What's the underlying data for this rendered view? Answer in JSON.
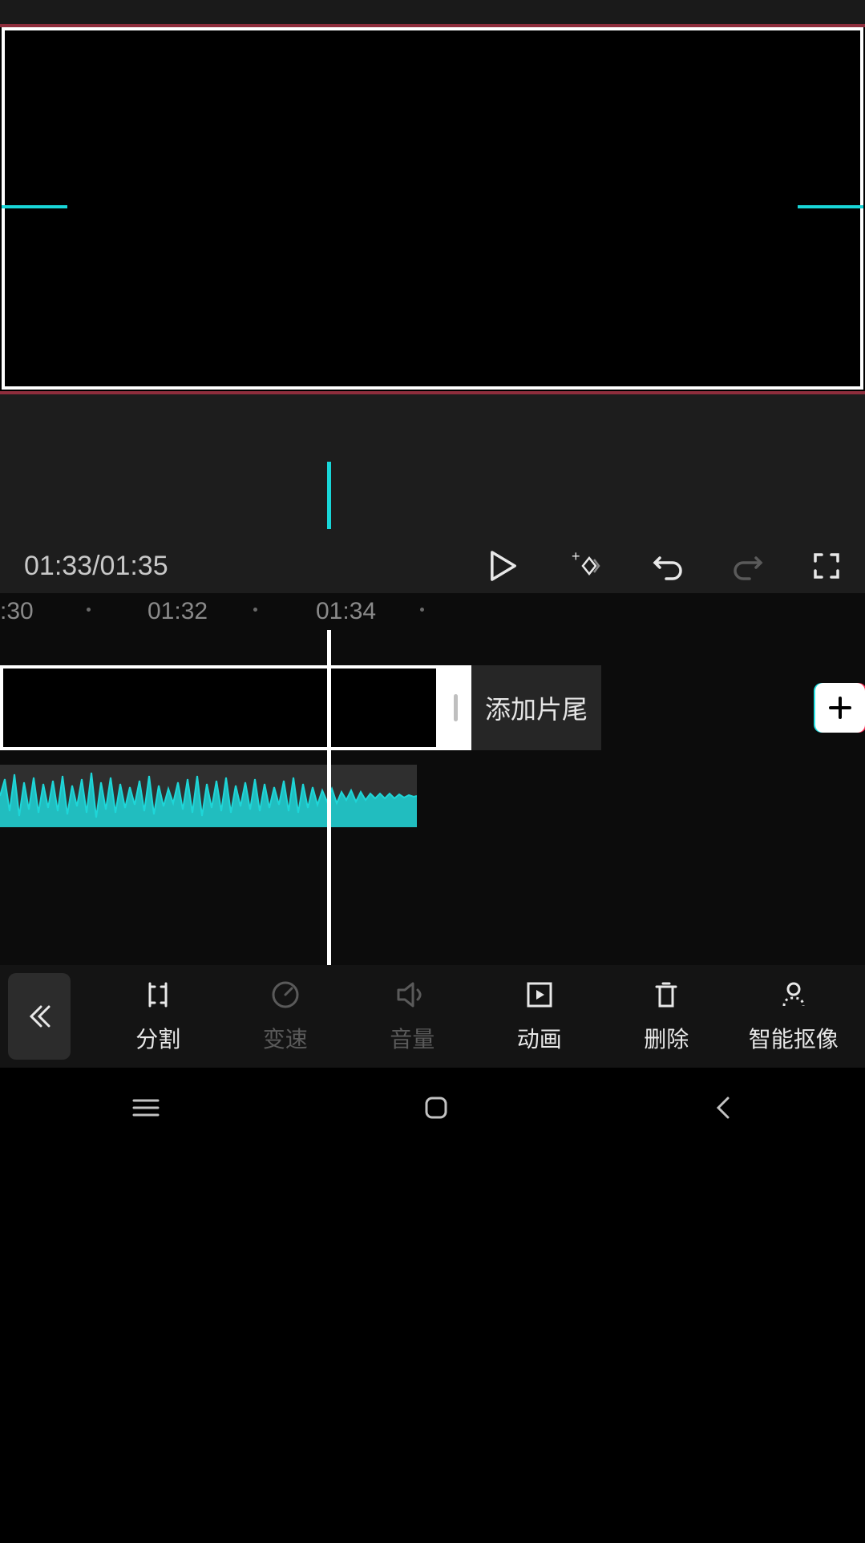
{
  "playback": {
    "time_label": "01:33/01:35"
  },
  "ruler": {
    "t0": ":30",
    "t1": "01:32",
    "t2": "01:34"
  },
  "timeline": {
    "add_tail_label": "添加片尾"
  },
  "toolbar": {
    "split": "分割",
    "speed": "变速",
    "volume": "音量",
    "animation": "动画",
    "delete": "删除",
    "cutout": "智能抠像"
  }
}
